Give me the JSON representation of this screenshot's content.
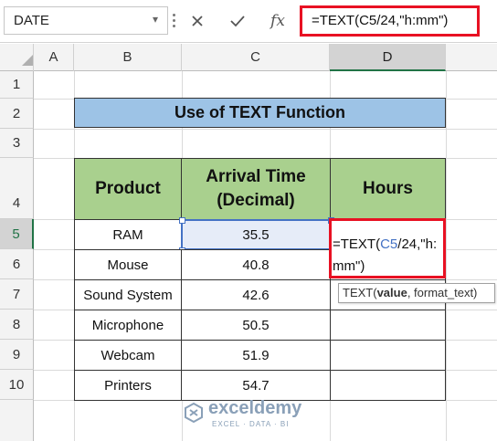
{
  "formula_bar": {
    "name_box": "DATE",
    "formula": "=TEXT(C5/24,\"h:mm\")",
    "cancel_icon": "x-icon",
    "enter_icon": "check-icon",
    "fx_label": "fx"
  },
  "columns": [
    "A",
    "B",
    "C",
    "D"
  ],
  "rows": [
    "1",
    "2",
    "3",
    "4",
    "5",
    "6",
    "7",
    "8",
    "9",
    "10"
  ],
  "sheet": {
    "title": "Use of TEXT Function",
    "headers": {
      "product": "Product",
      "arrival_line1": "Arrival Time",
      "arrival_line2": "(Decimal)",
      "hours": "Hours"
    },
    "data": [
      {
        "product": "RAM",
        "arrival": "35.5"
      },
      {
        "product": "Mouse",
        "arrival": "40.8"
      },
      {
        "product": "Sound System",
        "arrival": "42.6"
      },
      {
        "product": "Microphone",
        "arrival": "50.5"
      },
      {
        "product": "Webcam",
        "arrival": "51.9"
      },
      {
        "product": "Printers",
        "arrival": "54.7"
      }
    ],
    "editing": {
      "prefix": "=TEXT(",
      "ref": "C5",
      "suffix1": "/24,\"h:",
      "line2": "mm\")"
    },
    "tooltip": {
      "func": "TEXT(",
      "arg1": "value",
      "rest": ", format_text)"
    }
  },
  "watermark": {
    "name": "exceldemy",
    "tagline": "EXCEL · DATA · BI"
  },
  "colors": {
    "accent_green": "#217346",
    "header_green": "#a9d08e",
    "title_blue": "#9dc3e6",
    "highlight_red": "#e81123",
    "ref_blue": "#4472c4"
  }
}
